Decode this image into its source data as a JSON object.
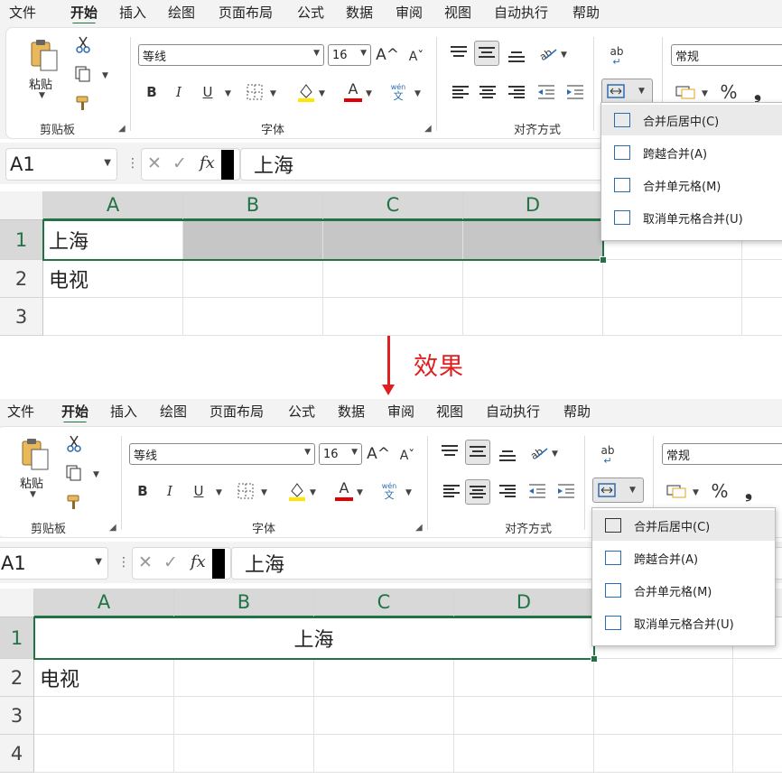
{
  "menu": {
    "tabs": [
      "文件",
      "开始",
      "插入",
      "绘图",
      "页面布局",
      "公式",
      "数据",
      "审阅",
      "视图",
      "自动执行",
      "帮助"
    ],
    "active_tab": "开始"
  },
  "ribbon": {
    "clipboard": {
      "paste_label": "粘贴",
      "group_label": "剪贴板"
    },
    "font": {
      "font_name": "等线",
      "font_size": "16",
      "grow_label": "A^",
      "shrink_label": "Aˇ",
      "bold": "B",
      "italic": "I",
      "underline": "U",
      "font_color_glyph": "A",
      "phonetic_top": "wén",
      "phonetic_bottom": "文",
      "group_label": "字体"
    },
    "alignment": {
      "group_label": "对齐方式",
      "wrap_label": "ab"
    },
    "number": {
      "format": "常规",
      "percent": "%",
      "comma": "❟"
    }
  },
  "formula_bar": {
    "name_box": "A1",
    "fx": "fx",
    "cancel": "✕",
    "enter": "✓",
    "value": "上海"
  },
  "grid": {
    "columns": [
      "A",
      "B",
      "C",
      "D"
    ],
    "rows_top": [
      "1",
      "2",
      "3"
    ],
    "rows_bottom": [
      "1",
      "2",
      "3",
      "4"
    ],
    "cell_a1": "上海",
    "cell_a2": "电视"
  },
  "merge_menu": {
    "items": [
      "合并后居中(C)",
      "跨越合并(A)",
      "合并单元格(M)",
      "取消单元格合并(U)"
    ]
  },
  "transition": {
    "label": "效果"
  },
  "colors": {
    "accent_green": "#217346",
    "arrow_red": "#e02020",
    "icon_blue": "#2b6cb0"
  }
}
